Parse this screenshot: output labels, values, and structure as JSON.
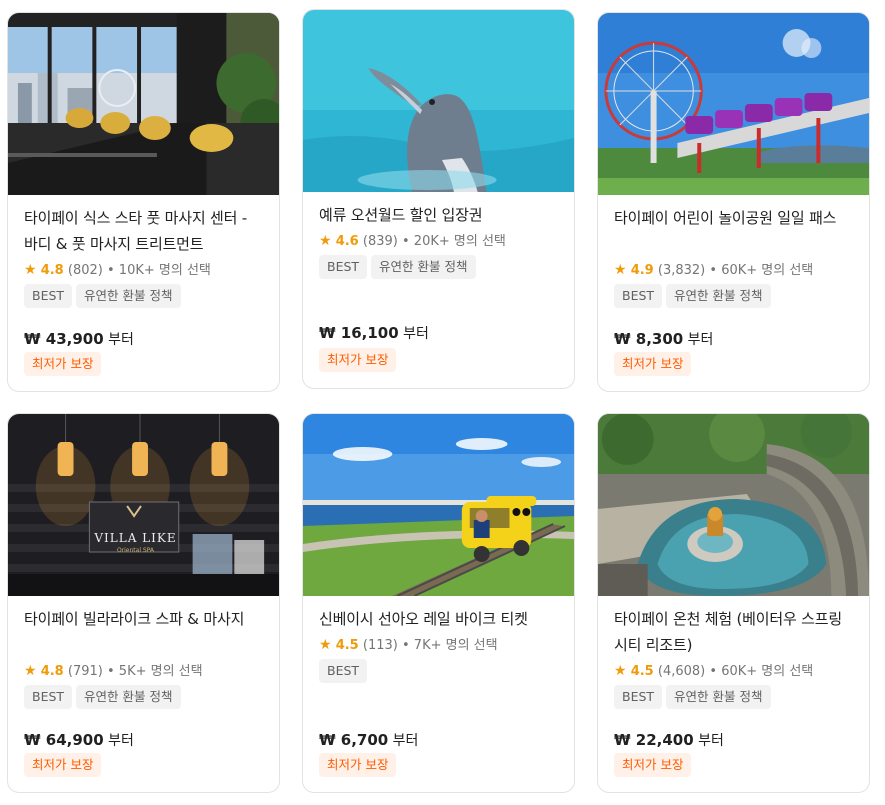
{
  "cards": [
    {
      "title": "타이페이 식스 스타 풋 마사지 센터 - 바디 & 풋 마사지 트리트먼트",
      "rating": "4.8",
      "reviews": "(802)",
      "booked": "10K+ 명의 선택",
      "tags": [
        "BEST",
        "유연한 환불 정책"
      ],
      "price": "₩ 43,900",
      "price_suffix": "부터",
      "badge": "최저가 보장",
      "image": "foot-massage-lounge-photo"
    },
    {
      "title": "예류 오션월드 할인 입장권",
      "rating": "4.6",
      "reviews": "(839)",
      "booked": "20K+ 명의 선택",
      "tags": [
        "BEST",
        "유연한 환불 정책"
      ],
      "price": "₩ 16,100",
      "price_suffix": "부터",
      "badge": "최저가 보장",
      "image": "dolphin-photo"
    },
    {
      "title": "타이페이 어린이 놀이공원 일일 패스",
      "rating": "4.9",
      "reviews": "(3,832)",
      "booked": "60K+ 명의 선택",
      "tags": [
        "BEST",
        "유연한 환불 정책"
      ],
      "price": "₩ 8,300",
      "price_suffix": "부터",
      "badge": "최저가 보장",
      "image": "ferris-wheel-photo"
    },
    {
      "title": "타이페이 빌라라이크 스파 & 마사지",
      "rating": "4.8",
      "reviews": "(791)",
      "booked": "5K+ 명의 선택",
      "tags": [
        "BEST",
        "유연한 환불 정책"
      ],
      "price": "₩ 64,900",
      "price_suffix": "부터",
      "badge": "최저가 보장",
      "image": "spa-entrance-photo",
      "logo_text": "VILLA LIKE",
      "logo_sub": "Oriental SPA"
    },
    {
      "title": "신베이시 선아오 레일 바이크 티켓",
      "rating": "4.5",
      "reviews": "(113)",
      "booked": "7K+ 명의 선택",
      "tags": [
        "BEST"
      ],
      "price": "₩ 6,700",
      "price_suffix": "부터",
      "badge": "최저가 보장",
      "image": "rail-bike-photo"
    },
    {
      "title": "타이페이 온천 체험 (베이터우 스프링 시티 리조트)",
      "rating": "4.5",
      "reviews": "(4,608)",
      "booked": "60K+ 명의 선택",
      "tags": [
        "BEST",
        "유연한 환불 정책"
      ],
      "price": "₩ 22,400",
      "price_suffix": "부터",
      "badge": "최저가 보장",
      "image": "hot-spring-pool-photo"
    }
  ],
  "meta_separator": "•",
  "star_glyph": "★",
  "colors": {
    "rating": "#f09b0a",
    "badge_text": "#ff5b00",
    "badge_bg": "#fff1e8",
    "tag_bg": "#f2f2f2"
  }
}
